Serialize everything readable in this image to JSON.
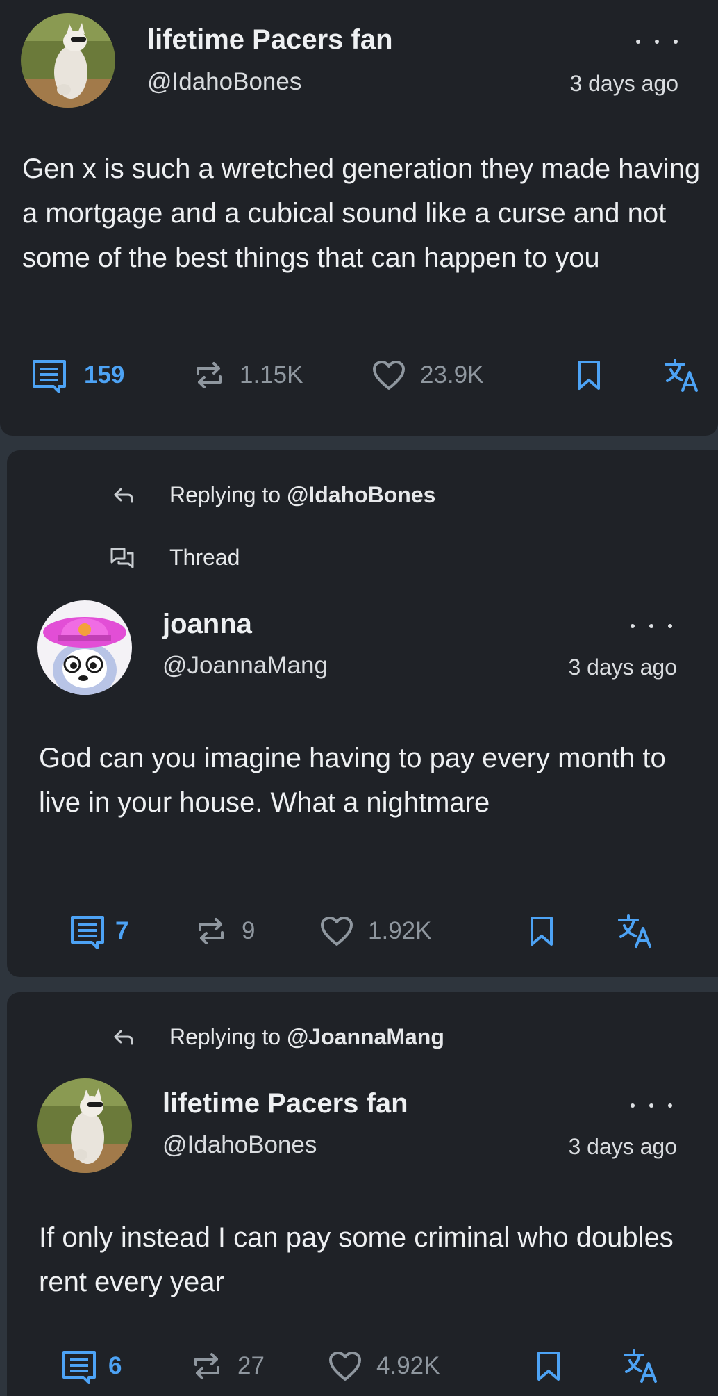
{
  "colors": {
    "background": "#2e353d",
    "card": "#1f2227",
    "accent_blue": "#4da3f5",
    "muted_icon": "#8f979f",
    "text": "#eef0f2"
  },
  "posts": [
    {
      "author": {
        "name": "lifetime Pacers fan",
        "handle": "@IdahoBones",
        "avatar": "cat-photo"
      },
      "time": "3 days ago",
      "text": "Gen x is such a wretched generation they made having a mortgage and a cubical sound like a curse and not some of the best things that can happen to you",
      "stats": {
        "replies": "159",
        "reposts": "1.15K",
        "likes": "23.9K"
      }
    },
    {
      "replying_label": "Replying to",
      "replying_to": "@IdahoBones",
      "thread_label": "Thread",
      "author": {
        "name": "joanna",
        "handle": "@JoannaMang",
        "avatar": "cartoon-dog-pink-hat"
      },
      "time": "3 days ago",
      "text": "God can you imagine having to pay every month to live in your house. What a nightmare",
      "stats": {
        "replies": "7",
        "reposts": "9",
        "likes": "1.92K"
      }
    },
    {
      "replying_label": "Replying to",
      "replying_to": "@JoannaMang",
      "author": {
        "name": "lifetime Pacers fan",
        "handle": "@IdahoBones",
        "avatar": "cat-photo"
      },
      "time": "3 days ago",
      "text": "If only instead I can pay some criminal who doubles rent every year",
      "stats": {
        "replies": "6",
        "reposts": "27",
        "likes": "4.92K"
      }
    }
  ],
  "icons": [
    "comment-icon",
    "repost-icon",
    "heart-icon",
    "bookmark-icon",
    "translate-icon",
    "reply-arrow-icon",
    "thread-icon",
    "more-options-icon"
  ]
}
